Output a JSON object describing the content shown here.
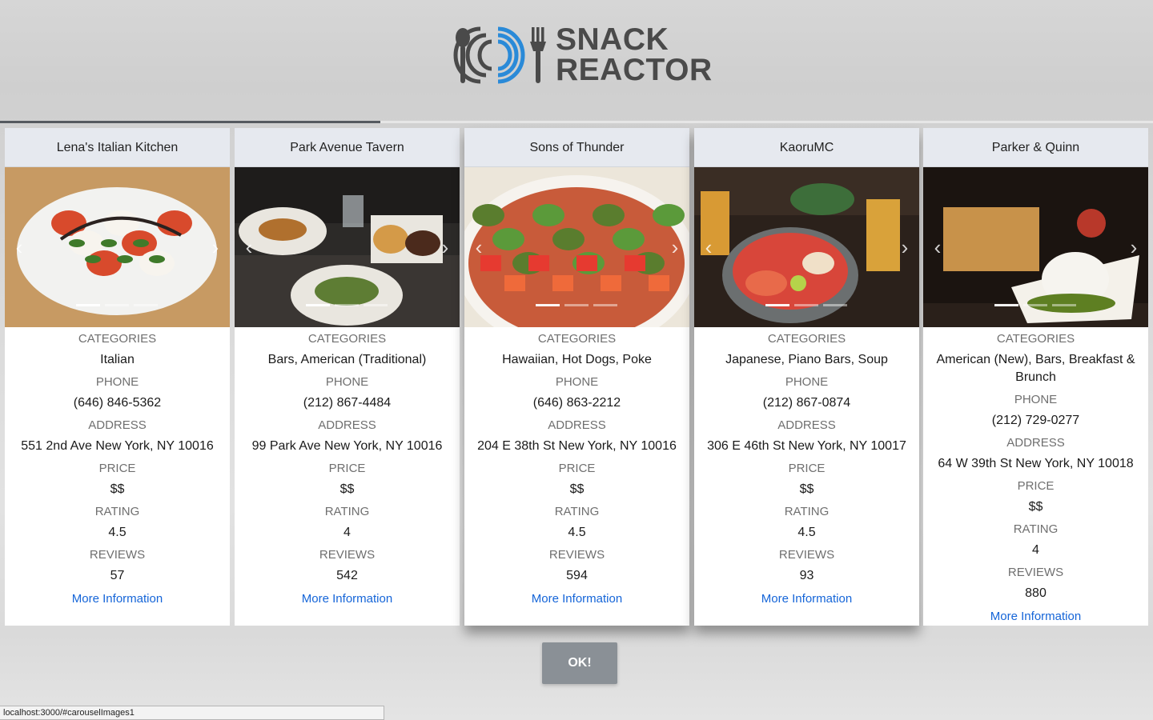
{
  "brand": {
    "line1": "SNACK",
    "line2": "REACTOR",
    "accent": "#2a8ad8",
    "ink": "#4a4a4a"
  },
  "progress": {
    "fraction": 0.33
  },
  "cards": [
    {
      "title": "Lena's Italian Kitchen",
      "categories_label": "CATEGORIES",
      "categories": "Italian",
      "phone_label": "PHONE",
      "phone": "(646) 846-5362",
      "address_label": "ADDRESS",
      "address": "551 2nd Ave New York, NY 10016",
      "price_label": "PRICE",
      "price": "$$",
      "rating_label": "RATING",
      "rating": "4.5",
      "reviews_label": "REVIEWS",
      "reviews": "57",
      "more_label": "More Information",
      "photo": "caprese salad on white plate",
      "palette": {
        "bg": "#c79a63",
        "plate": "#f2f2f0",
        "food": "#d84a2c",
        "accent": "#3f7a2a"
      }
    },
    {
      "title": "Park Avenue Tavern",
      "categories_label": "CATEGORIES",
      "categories": "Bars, American (Traditional)",
      "phone_label": "PHONE",
      "phone": "(212) 867-4484",
      "address_label": "ADDRESS",
      "address": "99 Park Ave New York, NY 10016",
      "price_label": "PRICE",
      "price": "$$",
      "rating_label": "RATING",
      "rating": "4",
      "reviews_label": "REVIEWS",
      "reviews": "542",
      "more_label": "More Information",
      "photo": "plates of waffles and salad on bar table",
      "palette": {
        "bg": "#2c2a28",
        "plate": "#e9e6df",
        "food": "#b0702e",
        "accent": "#5e7d34"
      }
    },
    {
      "title": "Sons of Thunder",
      "categories_label": "CATEGORIES",
      "categories": "Hawaiian, Hot Dogs, Poke",
      "phone_label": "PHONE",
      "phone": "(646) 863-2212",
      "address_label": "ADDRESS",
      "address": "204 E 38th St New York, NY 10016",
      "price_label": "PRICE",
      "price": "$$",
      "rating_label": "RATING",
      "rating": "4.5",
      "reviews_label": "REVIEWS",
      "reviews": "594",
      "more_label": "More Information",
      "photo": "poke bowl with salmon and greens",
      "palette": {
        "bg": "#ece6da",
        "plate": "#f6f3ee",
        "food": "#e8582a",
        "accent": "#5b9a3a"
      }
    },
    {
      "title": "KaoruMC",
      "categories_label": "CATEGORIES",
      "categories": "Japanese, Piano Bars, Soup",
      "phone_label": "PHONE",
      "phone": "(212) 867-0874",
      "address_label": "ADDRESS",
      "address": "306 E 46th St New York, NY 10017",
      "price_label": "PRICE",
      "price": "$$",
      "rating_label": "RATING",
      "rating": "4.5",
      "reviews_label": "REVIEWS",
      "reviews": "93",
      "more_label": "More Information",
      "photo": "sashimi bowl with beer glasses",
      "palette": {
        "bg": "#2b211b",
        "plate": "#6b6f70",
        "food": "#e86a4a",
        "accent": "#c9a347"
      }
    },
    {
      "title": "Parker & Quinn",
      "categories_label": "CATEGORIES",
      "categories": "American (New), Bars, Breakfast & Brunch",
      "phone_label": "PHONE",
      "phone": "(212) 729-0277",
      "address_label": "ADDRESS",
      "address": "64 W 39th St New York, NY 10018",
      "price_label": "PRICE",
      "price": "$$",
      "rating_label": "RATING",
      "rating": "4",
      "reviews_label": "REVIEWS",
      "reviews": "880",
      "more_label": "More Information",
      "photo": "burrata with toast and pesto",
      "palette": {
        "bg": "#1b1410",
        "plate": "#f4f1ea",
        "food": "#c8924a",
        "accent": "#5e7f22"
      }
    }
  ],
  "ok_button": {
    "label": "OK!"
  },
  "status_bar": {
    "url": "localhost:3000/#carouselImages1"
  }
}
